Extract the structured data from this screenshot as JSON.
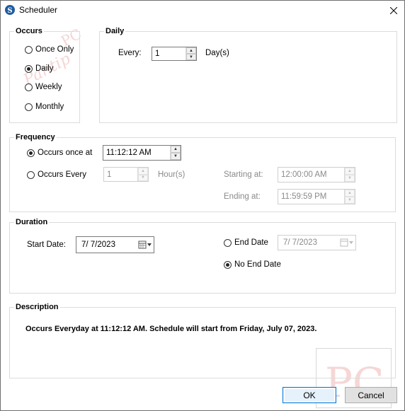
{
  "window": {
    "title": "Scheduler"
  },
  "occurs": {
    "legend": "Occurs",
    "options": [
      {
        "label": "Once Only",
        "selected": false
      },
      {
        "label": "Daily",
        "selected": true
      },
      {
        "label": "Weekly",
        "selected": false
      },
      {
        "label": "Monthly",
        "selected": false
      }
    ]
  },
  "daily": {
    "legend": "Daily",
    "every_label": "Every:",
    "every_value": "1",
    "unit_label": "Day(s)"
  },
  "frequency": {
    "legend": "Frequency",
    "once_label": "Occurs once at",
    "once_selected": true,
    "once_time": "11:12:12 AM",
    "every_label": "Occurs Every",
    "every_selected": false,
    "every_value": "1",
    "every_unit": "Hour(s)",
    "starting_label": "Starting at:",
    "starting_value": "12:00:00 AM",
    "ending_label": "Ending at:",
    "ending_value": "11:59:59 PM"
  },
  "duration": {
    "legend": "Duration",
    "start_label": "Start Date:",
    "start_value": "7/  7/2023",
    "end_date_label": "End Date",
    "end_date_selected": false,
    "end_date_value": "7/  7/2023",
    "no_end_label": "No End Date",
    "no_end_selected": true
  },
  "description": {
    "legend": "Description",
    "text": "Occurs Everyday at 11:12:12 AM. Schedule will start from Friday, July 07, 2023."
  },
  "buttons": {
    "ok": "OK",
    "cancel": "Cancel"
  },
  "watermark": {
    "script": "Pantip",
    "brand": "PC",
    "mark": "PC"
  },
  "colors": {
    "accent": "#0078d7",
    "icon": "#1e5c9e"
  }
}
